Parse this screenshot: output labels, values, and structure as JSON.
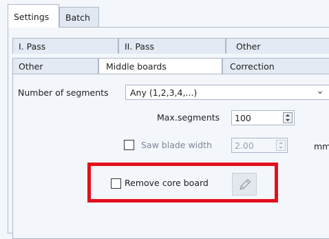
{
  "top_tabs": [
    "Settings",
    "Batch"
  ],
  "sub_tabs_row1": [
    "I. Pass",
    "II. Pass",
    "Other"
  ],
  "sub_tabs_row2": [
    "Other",
    "Middle boards",
    "Correction"
  ],
  "segments": {
    "label": "Number of segments",
    "value": "Any (1,2,3,4,...)"
  },
  "max_segments": {
    "label": "Max.segments",
    "value": "100"
  },
  "saw_blade": {
    "label": "Saw blade width",
    "value": "2.00",
    "unit": "mm",
    "checked": false
  },
  "core_board": {
    "label": "Remove core board",
    "checked": false
  },
  "colors": {
    "highlight": "#e3101c",
    "tab_border": "#aeb8c8",
    "panel_bg": "#f3f6fb"
  },
  "icons": {
    "dropdown": "chevron-down-icon",
    "edit": "pencil-icon"
  }
}
